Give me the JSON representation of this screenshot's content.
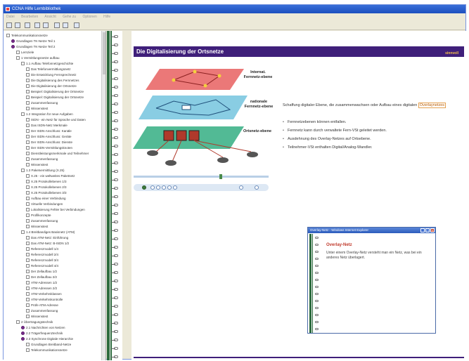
{
  "window": {
    "title": "CCNA Hilfe Lernbibliothek",
    "menu": [
      "Datei",
      "Bearbeiten",
      "Ansicht",
      "Gehe zu",
      "Optionen",
      "Hilfe"
    ]
  },
  "toolbar": {
    "buttons": [
      "print-icon",
      "save-icon",
      "search-icon",
      "up-icon",
      "down-icon",
      "back-icon",
      "forward-icon",
      "home-icon"
    ]
  },
  "sidebar": {
    "items": [
      {
        "label": "Telekommunikationsnetze",
        "indent": 0,
        "icon": "book"
      },
      {
        "label": "Grundlagen TK-Netze Teil 1",
        "indent": 1,
        "icon": "purple"
      },
      {
        "label": "Grundlagen TK-Netze Teil 2",
        "indent": 1,
        "icon": "purple"
      },
      {
        "label": "Lernziele",
        "indent": 2,
        "icon": "page"
      },
      {
        "label": "1 Vermittlungsnetze aufbau",
        "indent": 2,
        "icon": "book"
      },
      {
        "label": "1.1 Aufbau Telefonnetzgeschichte",
        "indent": 3,
        "icon": "book"
      },
      {
        "label": "Das Telefonvermittlungsnetz",
        "indent": 4,
        "icon": "page"
      },
      {
        "label": "Die Entwicklung Fernsprechnetz",
        "indent": 4,
        "icon": "page"
      },
      {
        "label": "Die Digitalisierung des Fernnetzes",
        "indent": 4,
        "icon": "page"
      },
      {
        "label": "Die Digitalisierung der Ortsnetze",
        "indent": 4,
        "icon": "page"
      },
      {
        "label": "Beispiel: Digitalisierung der Ortsnetze",
        "indent": 4,
        "icon": "page"
      },
      {
        "label": "Beispiel: Digitalisierung der Ortsnetze",
        "indent": 4,
        "icon": "page"
      },
      {
        "label": "Zusammenfassung",
        "indent": 4,
        "icon": "page"
      },
      {
        "label": "Wissenstest",
        "indent": 4,
        "icon": "page"
      },
      {
        "label": "1.2 Integration für neue Aufgaben",
        "indent": 3,
        "icon": "book"
      },
      {
        "label": "ISDN - ein Netz für Sprache und Daten",
        "indent": 4,
        "icon": "page"
      },
      {
        "label": "Das ISDN-Netz Merkmale",
        "indent": 4,
        "icon": "page"
      },
      {
        "label": "Der ISDN-Anschluss: Kanäle",
        "indent": 4,
        "icon": "page"
      },
      {
        "label": "Der ISDN-Anschluss: Geräte",
        "indent": 4,
        "icon": "page"
      },
      {
        "label": "Der ISDN-Anschluss: Dienste",
        "indent": 4,
        "icon": "page"
      },
      {
        "label": "Der ISDN-Vermittlungsknoten",
        "indent": 4,
        "icon": "page"
      },
      {
        "label": "Dienstleistungsmerkmale und Teilnehmer",
        "indent": 4,
        "icon": "page"
      },
      {
        "label": "Zusammenfassung",
        "indent": 4,
        "icon": "page"
      },
      {
        "label": "Wissenstest",
        "indent": 4,
        "icon": "page"
      },
      {
        "label": "1.3 Paketvermittlung (X.25)",
        "indent": 3,
        "icon": "book"
      },
      {
        "label": "X.25 - ein weltweites Paketnetz",
        "indent": 4,
        "icon": "page"
      },
      {
        "label": "X.25 Protokollebenen 1/3",
        "indent": 4,
        "icon": "page"
      },
      {
        "label": "X.25 Protokollebenen 2/3",
        "indent": 4,
        "icon": "page"
      },
      {
        "label": "X.25 Protokollebenen 3/3",
        "indent": 4,
        "icon": "page"
      },
      {
        "label": "Aufbau einer Verbindung",
        "indent": 4,
        "icon": "page"
      },
      {
        "label": "Virtuelle Verbindungen",
        "indent": 4,
        "icon": "page"
      },
      {
        "label": "Lokalisierung Fehler bei Verbindungen",
        "indent": 4,
        "icon": "page"
      },
      {
        "label": "Profilkonzepte",
        "indent": 4,
        "icon": "page"
      },
      {
        "label": "Zusammenfassung",
        "indent": 4,
        "icon": "page"
      },
      {
        "label": "Wissenstest",
        "indent": 4,
        "icon": "page"
      },
      {
        "label": "1.4 Breitbandiges Basisnetz (ATM)",
        "indent": 3,
        "icon": "book"
      },
      {
        "label": "Das ATM-Netz: Einführung",
        "indent": 4,
        "icon": "page"
      },
      {
        "label": "Das ATM-Netz: B-ISDN 1/2",
        "indent": 4,
        "icon": "page"
      },
      {
        "label": "Referenzmodell 1/4",
        "indent": 4,
        "icon": "page"
      },
      {
        "label": "Referenzmodell 2/4",
        "indent": 4,
        "icon": "page"
      },
      {
        "label": "Referenzmodell 3/4",
        "indent": 4,
        "icon": "page"
      },
      {
        "label": "Referenzmodell 4/4",
        "indent": 4,
        "icon": "page"
      },
      {
        "label": "Der Zellaufbau 1/2",
        "indent": 4,
        "icon": "page"
      },
      {
        "label": "Der Zellaufbau 2/2",
        "indent": 4,
        "icon": "page"
      },
      {
        "label": "ATM-Adressen 1/2",
        "indent": 4,
        "icon": "page"
      },
      {
        "label": "ATM-Adressen 2/2",
        "indent": 4,
        "icon": "page"
      },
      {
        "label": "ATM-Verkehrsklassen",
        "indent": 4,
        "icon": "page"
      },
      {
        "label": "ATM-Verkehrskontrolle",
        "indent": 4,
        "icon": "page"
      },
      {
        "label": "Prüfe ATM-Adresse",
        "indent": 4,
        "icon": "page"
      },
      {
        "label": "Zusammenfassung",
        "indent": 4,
        "icon": "page"
      },
      {
        "label": "Wissenstest",
        "indent": 4,
        "icon": "page"
      },
      {
        "label": "2 Übertragungstechnik",
        "indent": 2,
        "icon": "book"
      },
      {
        "label": "2.1 Nachrichten von Netzen",
        "indent": 3,
        "icon": "purple"
      },
      {
        "label": "2.2 Trägerfrequenztechnik",
        "indent": 3,
        "icon": "purple"
      },
      {
        "label": "2.3 Synchrone Digitale Hierarchie",
        "indent": 3,
        "icon": "purple"
      },
      {
        "label": "Grundlagen Breitband-Netze",
        "indent": 4,
        "icon": "page"
      },
      {
        "label": "Telekommunikationsnetze",
        "indent": 4,
        "icon": "page"
      }
    ]
  },
  "content": {
    "banner_title": "Die Digitalisierung der Ortsnetze",
    "banner_logo": "sinnvoll",
    "levels": [
      "Internat. Fernnetz-ebene",
      "nationale Fernnetz-ebene",
      "Ortsnetz-ebene"
    ],
    "lead_prefix": "Schaffung digitaler Ebene, die zusammenwachsen oder Aufbau eines digitalen",
    "lead_link": "Overlaynetzes",
    "bullets": [
      "Fernnetzebenen können entfallen.",
      "Fernnetz kann durch verwaltete Fern-VSt geleitet werden.",
      "Ausdehnung des Overlay-Netzes auf Ortsebene.",
      "Teilnehmer-VSt enthalten Digital/Analog-Wandler."
    ],
    "progress_fraction": 0.65
  },
  "popup": {
    "title": "Overlay-Netz - Windows Internet Explorer",
    "heading": "Overlay-Netz",
    "body": "Unter einem Overlay-Netz versteht man ein Netz, was bei ein anderes Netz überlagert."
  },
  "colors": {
    "banner": "#3f1f7a",
    "binder": "#2d6b3e",
    "accent": "#b85a00"
  }
}
